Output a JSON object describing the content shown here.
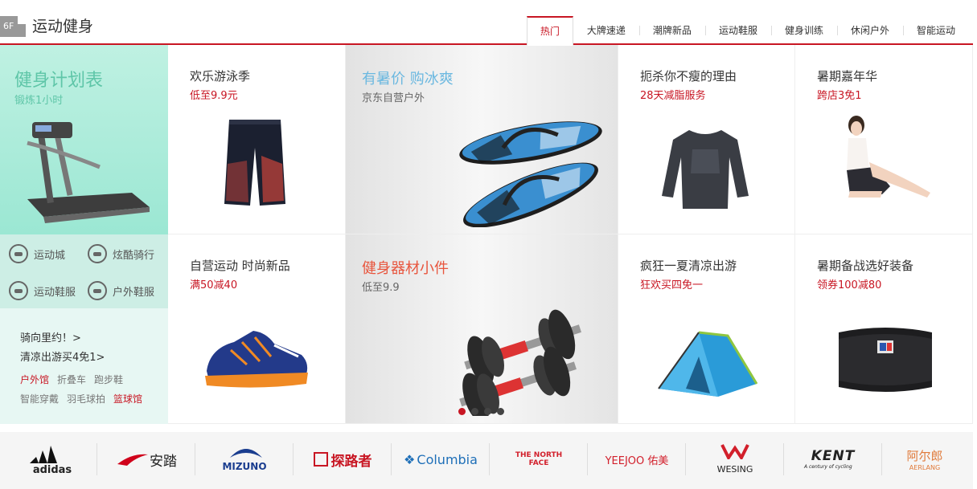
{
  "header": {
    "floor": "6F",
    "title": "运动健身",
    "tabs": [
      "热门",
      "大牌速递",
      "潮牌新品",
      "运动鞋服",
      "健身训练",
      "休闲户外",
      "智能运动"
    ],
    "accent": "#c81623"
  },
  "left": {
    "title": "健身计划表",
    "subtitle": "锻炼1小时",
    "categories": [
      "运动城",
      "炫酷骑行",
      "运动鞋服",
      "户外鞋服"
    ],
    "links": [
      "骑向里约！>",
      "清凉出游买4免1>"
    ],
    "keywords": [
      {
        "text": "户外馆",
        "hot": true
      },
      {
        "text": "折叠车",
        "hot": false
      },
      {
        "text": "跑步鞋",
        "hot": false
      },
      {
        "text": "智能穿戴",
        "hot": false
      },
      {
        "text": "羽毛球拍",
        "hot": false
      },
      {
        "text": "篮球馆",
        "hot": true
      }
    ]
  },
  "cards": [
    {
      "title": "欢乐游泳季",
      "sub": "低至9.9元",
      "icon": "swim-trunks-icon"
    },
    {
      "title": "扼杀你不瘦的理由",
      "sub": "28天减脂服务",
      "icon": "compression-shirt-icon"
    },
    {
      "title": "暑期嘉年华",
      "sub": "跨店3免1",
      "icon": "yoga-woman-icon"
    },
    {
      "title": "自营运动 时尚新品",
      "sub": "满50减40",
      "icon": "running-shoe-icon"
    },
    {
      "title": "疯狂一夏清凉出游",
      "sub": "狂欢买四免一",
      "icon": "tent-icon"
    },
    {
      "title": "暑期备战选好装备",
      "sub": "领券100减80",
      "icon": "waist-belt-icon"
    }
  ],
  "big": [
    {
      "title": "有暑价 购冰爽",
      "sub": "京东自营户外",
      "color": "#6bb8e0",
      "icon": "flip-flops-icon"
    },
    {
      "title": "健身器材小件",
      "sub": "低至9.9",
      "color": "#e8553d",
      "icon": "dumbbells-icon"
    }
  ],
  "brands": [
    "adidas",
    "安踏",
    "MIZUNO",
    "探路者",
    "Columbia",
    "THE NORTH FACE",
    "YEEJOO 佑美",
    "WESING",
    "KENT",
    "阿尔郎",
    "AERLANG",
    "A century of cycling"
  ]
}
